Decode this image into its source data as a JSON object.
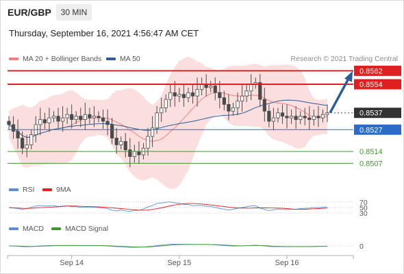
{
  "header": {
    "symbol": "EUR/GBP",
    "timeframe": "30 MIN",
    "datetime": "Thursday, September 16, 2021 4:56:47 AM CET",
    "credit": "Research © 2021 Trading Central"
  },
  "legends": {
    "main": [
      {
        "label": "MA 20 + Bollinger Bands",
        "color": "#f08080"
      },
      {
        "label": "MA 50",
        "color": "#2c5c9c"
      }
    ],
    "rsi": [
      {
        "label": "RSI",
        "color": "#5b8cd6"
      },
      {
        "label": "9MA",
        "color": "#e02020"
      }
    ],
    "macd": [
      {
        "label": "MACD",
        "color": "#5b8cd6"
      },
      {
        "label": "MACD Signal",
        "color": "#3a9a2a"
      }
    ]
  },
  "colors": {
    "resistance": "#e02020",
    "pivot": "#2a6cc8",
    "support": "#3a9a2a",
    "last_price_box": "#333333",
    "candle": "#4a4a4a",
    "bollinger_fill": "#fbdcdc",
    "arrow": "#2c5c9c"
  },
  "chart_data": {
    "type": "candlestick",
    "symbol": "EUR/GBP",
    "interval": "30 MIN",
    "ylim": [
      0.8499,
      0.8565
    ],
    "x_ticks": [
      {
        "label": "Sep 14",
        "index": 14
      },
      {
        "label": "Sep 15",
        "index": 38
      },
      {
        "label": "Sep 16",
        "index": 62
      }
    ],
    "levels": [
      {
        "label": "0.8562",
        "value": 0.8562,
        "type": "resistance"
      },
      {
        "label": "0.8554",
        "value": 0.8554,
        "type": "resistance"
      },
      {
        "label": "0.8537",
        "value": 0.8537,
        "type": "last"
      },
      {
        "label": "0.8527",
        "value": 0.8527,
        "type": "pivot"
      },
      {
        "label": "0.8514",
        "value": 0.8514,
        "type": "support"
      },
      {
        "label": "0.8507",
        "value": 0.8507,
        "type": "support"
      }
    ],
    "forecast_arrow": {
      "from": 0.8537,
      "to": 0.8559
    },
    "close": [
      0.853,
      0.8526,
      0.8522,
      0.8516,
      0.8518,
      0.8524,
      0.853,
      0.8533,
      0.8531,
      0.8534,
      0.8535,
      0.8532,
      0.8534,
      0.8536,
      0.8533,
      0.8535,
      0.8533,
      0.8536,
      0.8534,
      0.8535,
      0.8534,
      0.8532,
      0.853,
      0.8522,
      0.8518,
      0.852,
      0.8515,
      0.8511,
      0.8514,
      0.8512,
      0.8516,
      0.8523,
      0.8528,
      0.8537,
      0.854,
      0.8545,
      0.8549,
      0.8547,
      0.8548,
      0.8546,
      0.8549,
      0.8547,
      0.8551,
      0.8554,
      0.8552,
      0.8553,
      0.8549,
      0.8546,
      0.8542,
      0.8538,
      0.854,
      0.8544,
      0.8547,
      0.855,
      0.8554,
      0.8555,
      0.8545,
      0.8538,
      0.8532,
      0.8534,
      0.8537,
      0.8535,
      0.8534,
      0.8535,
      0.8533,
      0.8535,
      0.8534,
      0.8533,
      0.8535,
      0.8534,
      0.8536,
      0.8537
    ],
    "ma20_center": 0.8535,
    "rsi_levels": [
      70,
      50,
      30
    ],
    "macd_zero_label": "0"
  }
}
